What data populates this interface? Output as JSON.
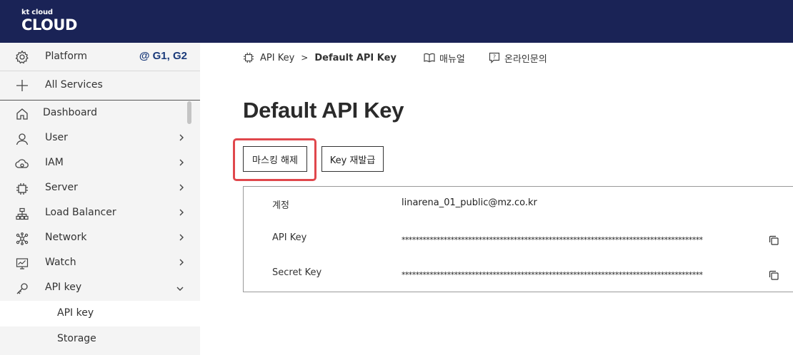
{
  "header": {
    "logo_small": "kt cloud",
    "logo_big": "CLOUD"
  },
  "sidebar": {
    "platform_label": "Platform",
    "region_label": "@ G1, G2",
    "all_services_label": "All Services",
    "items": [
      {
        "label": "Dashboard",
        "icon": "home-icon"
      },
      {
        "label": "User",
        "icon": "user-icon"
      },
      {
        "label": "IAM",
        "icon": "cloud-icon"
      },
      {
        "label": "Server",
        "icon": "chip-icon"
      },
      {
        "label": "Load Balancer",
        "icon": "network-tree-icon"
      },
      {
        "label": "Network",
        "icon": "network-nodes-icon"
      },
      {
        "label": "Watch",
        "icon": "monitor-chart-icon"
      },
      {
        "label": "API key",
        "icon": "key-icon"
      }
    ],
    "sub_items": [
      {
        "label": "API key",
        "active": true
      },
      {
        "label": "Storage",
        "active": false
      }
    ]
  },
  "breadcrumb": {
    "parent": "API Key",
    "separator": ">",
    "current": "Default API Key"
  },
  "top_links": {
    "manual": "매뉴얼",
    "inquiry": "온라인문의"
  },
  "page": {
    "title": "Default API Key",
    "buttons": {
      "unmask": "마스킹 해제",
      "reissue": "Key 재발급"
    }
  },
  "info": {
    "rows": [
      {
        "key": "계정",
        "value": "linarena_01_public@mz.co.kr",
        "copyable": false
      },
      {
        "key": "API Key",
        "value": "**************************************************************************************",
        "copyable": true
      },
      {
        "key": "Secret Key",
        "value": "**************************************************************************************",
        "copyable": true
      }
    ]
  },
  "colors": {
    "header_bg": "#1a2356",
    "region": "#1a3a7a",
    "highlight": "#e0474c",
    "sidebar_bg": "#f4f4f4"
  }
}
